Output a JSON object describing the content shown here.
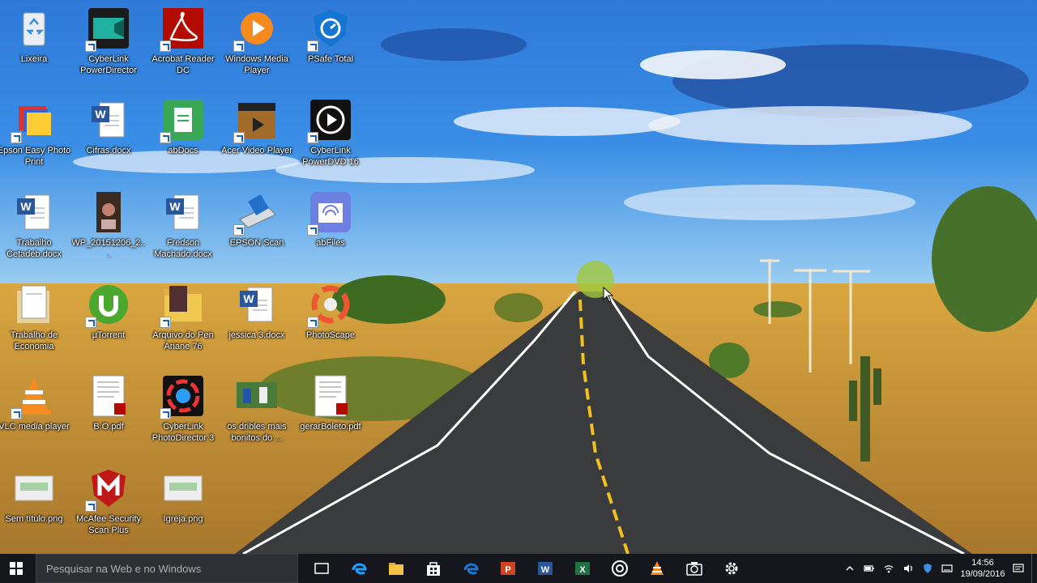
{
  "desktop": {
    "icons": [
      {
        "label": "Lixeira",
        "icon": "recycle-bin-icon"
      },
      {
        "label": "CyberLink PowerDirector",
        "icon": "cyberlink-powerdirector-icon"
      },
      {
        "label": "Acrobat Reader DC",
        "icon": "acrobat-reader-icon"
      },
      {
        "label": "Windows Media Player",
        "icon": "windows-media-player-icon"
      },
      {
        "label": "PSafe Total",
        "icon": "psafe-total-icon"
      },
      {
        "label": "Epson Easy Photo Print",
        "icon": "epson-easy-photo-print-icon"
      },
      {
        "label": "Cifras.docx",
        "icon": "word-document-icon"
      },
      {
        "label": "abDocs",
        "icon": "abdocs-icon"
      },
      {
        "label": "Acer Video Player",
        "icon": "acer-video-player-icon"
      },
      {
        "label": "CyberLink PowerDVD 16",
        "icon": "cyberlink-powerdvd-icon"
      },
      {
        "label": "Trabalho Cetadeb.docx",
        "icon": "word-document-icon"
      },
      {
        "label": "WP_20151206_2...",
        "icon": "photo-file-icon"
      },
      {
        "label": "Fredson Machado.docx",
        "icon": "word-document-icon"
      },
      {
        "label": "EPSON Scan",
        "icon": "epson-scan-icon"
      },
      {
        "label": "abFiles",
        "icon": "abfiles-icon"
      },
      {
        "label": "Trabalho de Economia",
        "icon": "folder-document-icon"
      },
      {
        "label": "µTorrent",
        "icon": "utorrent-icon"
      },
      {
        "label": "Arquivo do Pen Ariane 76",
        "icon": "folder-icon"
      },
      {
        "label": "jessica 3.docx",
        "icon": "word-document-icon"
      },
      {
        "label": "PhotoScape",
        "icon": "photoscape-icon"
      },
      {
        "label": "VLC media player",
        "icon": "vlc-icon"
      },
      {
        "label": "B.O.pdf",
        "icon": "pdf-document-icon"
      },
      {
        "label": "CyberLink PhotoDirector 3",
        "icon": "cyberlink-photodirector-icon"
      },
      {
        "label": "os dribles mais bonitos do ...",
        "icon": "video-thumbnail-icon"
      },
      {
        "label": "gerarBoleto.pdf",
        "icon": "pdf-document-icon"
      },
      {
        "label": "Sem título.png",
        "icon": "image-file-icon"
      },
      {
        "label": "McAfee Security Scan Plus",
        "icon": "mcafee-icon"
      },
      {
        "label": "Igreja.png",
        "icon": "image-file-icon"
      }
    ]
  },
  "taskbar": {
    "search_placeholder": "Pesquisar na Web e no Windows",
    "apps": [
      "task-view-icon",
      "edge-icon",
      "file-explorer-icon",
      "store-icon",
      "edge-blue-icon",
      "powerpoint-icon",
      "word-icon",
      "excel-icon",
      "groove-icon",
      "vlc-icon",
      "camera-icon",
      "settings-icon"
    ],
    "tray": [
      "chevron-up-icon",
      "battery-icon",
      "wifi-icon",
      "volume-icon",
      "security-shield-icon",
      "keyboard-icon"
    ],
    "time": "14:56",
    "date": "19/09/2016",
    "notifications_icon": "action-center-icon"
  }
}
